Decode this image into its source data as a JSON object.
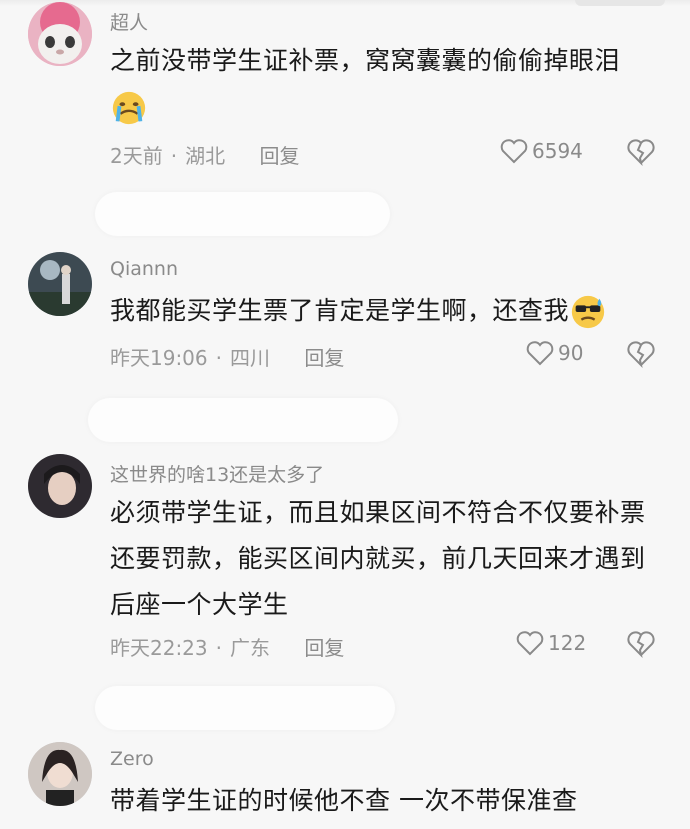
{
  "comments": [
    {
      "username": "超人",
      "text": "之前没带学生证补票，窝窝囊囊的偷偷掉眼泪",
      "emoji": "crying-face",
      "time": "2天前",
      "location": "湖北",
      "reply": "回复",
      "likes": "6594"
    },
    {
      "username": "Qiannn",
      "text": "我都能买学生票了肯定是学生啊，还查我",
      "emoji": "sunglasses-sweat-face",
      "time": "昨天19:06",
      "location": "四川",
      "reply": "回复",
      "likes": "90"
    },
    {
      "username": "这世界的啥13还是太多了",
      "text": "必须带学生证，而且如果区间不符合不仅要补票还要罚款，能买区间内就买，前几天回来才遇到后座一个大学生",
      "time": "昨天22:23",
      "location": "广东",
      "reply": "回复",
      "likes": "122"
    },
    {
      "username": "Zero",
      "text": "带着学生证的时候他不查 一次不带保准查"
    }
  ],
  "colors": {
    "background": "#f7f7f7",
    "text": "#1a1a1a",
    "meta": "#9a9a9a"
  }
}
